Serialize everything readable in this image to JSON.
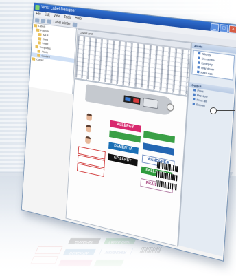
{
  "window": {
    "title": "Wrist Label Designer",
    "controls": [
      "_",
      "□",
      "×"
    ]
  },
  "menu": [
    "File",
    "Edit",
    "View",
    "Tools",
    "Help"
  ],
  "toolbar": {
    "label": "Label printer"
  },
  "tree": {
    "nodes": [
      "Labels",
      "Patients",
      "Adult",
      "Child",
      "Infant",
      "Templates",
      "Alerts",
      "Custom",
      "Output"
    ]
  },
  "grid": {
    "header": "Layout grid"
  },
  "labels": {
    "allergy": "ALLERGY",
    "dementia": "DEMENTIA",
    "epilepsy": "EPILEPSY",
    "wanderer": "WANDERER",
    "falls_risk": "FALLS RISK",
    "frail_skin": "FRAIL SKIN"
  },
  "right_panel": {
    "header": "Alerts",
    "items": [
      "Allergy",
      "Dementia",
      "Epilepsy",
      "Wanderer",
      "Falls risk"
    ],
    "section2": "Output",
    "items2": [
      "Print",
      "Preview",
      "Print all",
      "Export"
    ]
  },
  "colors": {
    "title_bar": "#1e4fa8",
    "dementia": "#1a6fb5",
    "epilepsy": "#111111",
    "wanderer": "#1d4d9b",
    "falls_risk": "#2e9a3c",
    "frail_skin": "#9b2c6f",
    "pink_alert": "#d8296e"
  }
}
